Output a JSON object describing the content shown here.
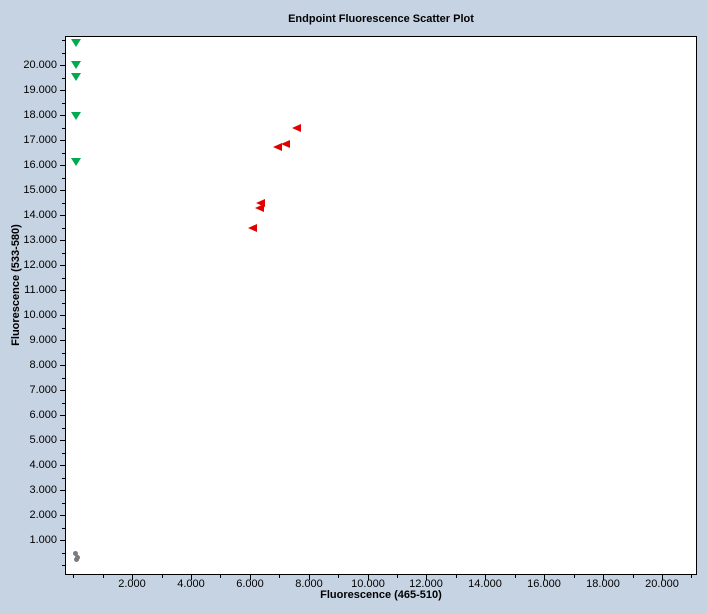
{
  "window": {
    "background_color": "#c6d3e3",
    "plot_background_color": "#ffffff",
    "border_color": "#000000"
  },
  "chart_data": {
    "type": "scatter",
    "title": "Endpoint Fluorescence Scatter Plot",
    "grid": false,
    "legend": "none",
    "x_axis": {
      "label": "Fluorescence (465-510)",
      "range": [
        -0.28,
        21.19
      ],
      "major_ticks": [
        {
          "v": 2,
          "label": "2.000"
        },
        {
          "v": 4,
          "label": "4.000"
        },
        {
          "v": 6,
          "label": "6.000"
        },
        {
          "v": 8,
          "label": "8.000"
        },
        {
          "v": 10,
          "label": "10.000"
        },
        {
          "v": 12,
          "label": "12.000"
        },
        {
          "v": 14,
          "label": "14.000"
        },
        {
          "v": 16,
          "label": "16.000"
        },
        {
          "v": 18,
          "label": "18.000"
        },
        {
          "v": 20,
          "label": "20.000"
        }
      ],
      "minor_ticks": [
        0,
        1,
        3,
        5,
        7,
        9,
        11,
        13,
        15,
        17,
        19,
        21
      ]
    },
    "y_axis": {
      "label": "Fluorescence (533-580)",
      "range": [
        -0.4,
        21.16
      ],
      "major_ticks": [
        {
          "v": 1,
          "label": "1.000"
        },
        {
          "v": 2,
          "label": "2.000"
        },
        {
          "v": 3,
          "label": "3.000"
        },
        {
          "v": 4,
          "label": "4.000"
        },
        {
          "v": 5,
          "label": "5.000"
        },
        {
          "v": 6,
          "label": "6.000"
        },
        {
          "v": 7,
          "label": "7.000"
        },
        {
          "v": 8,
          "label": "8.000"
        },
        {
          "v": 9,
          "label": "9.000"
        },
        {
          "v": 10,
          "label": "10.000"
        },
        {
          "v": 11,
          "label": "11.000"
        },
        {
          "v": 12,
          "label": "12.000"
        },
        {
          "v": 13,
          "label": "13.000"
        },
        {
          "v": 14,
          "label": "14.000"
        },
        {
          "v": 15,
          "label": "15.000"
        },
        {
          "v": 16,
          "label": "16.000"
        },
        {
          "v": 17,
          "label": "17.000"
        },
        {
          "v": 18,
          "label": "18.000"
        },
        {
          "v": 19,
          "label": "19.000"
        },
        {
          "v": 20,
          "label": "20.000"
        }
      ],
      "minor_ticks": [
        0,
        0.5,
        1.5,
        2.5,
        3.5,
        4.5,
        5.5,
        6.5,
        7.5,
        8.5,
        9.5,
        10.5,
        11.5,
        12.5,
        13.5,
        14.5,
        15.5,
        16.5,
        17.5,
        18.5,
        19.5,
        20.5,
        21
      ]
    },
    "series": [
      {
        "name": "green-down-triangles",
        "marker": "triangle-down",
        "color": "#00ab4e",
        "points": [
          [
            0.1,
            20.88
          ],
          [
            0.1,
            20.0
          ],
          [
            0.1,
            19.52
          ],
          [
            0.1,
            17.96
          ],
          [
            0.1,
            16.12
          ]
        ]
      },
      {
        "name": "red-left-triangles",
        "marker": "triangle-left",
        "color": "#e00000",
        "points": [
          [
            7.6,
            17.48
          ],
          [
            7.23,
            16.84
          ],
          [
            6.96,
            16.72
          ],
          [
            6.38,
            14.48
          ],
          [
            6.35,
            14.28
          ],
          [
            6.11,
            13.48
          ]
        ]
      },
      {
        "name": "gray-dots",
        "marker": "circle",
        "color": "#7a7a7a",
        "points": [
          [
            0.06,
            0.48
          ],
          [
            0.13,
            0.32
          ],
          [
            0.1,
            0.22
          ]
        ]
      }
    ]
  }
}
